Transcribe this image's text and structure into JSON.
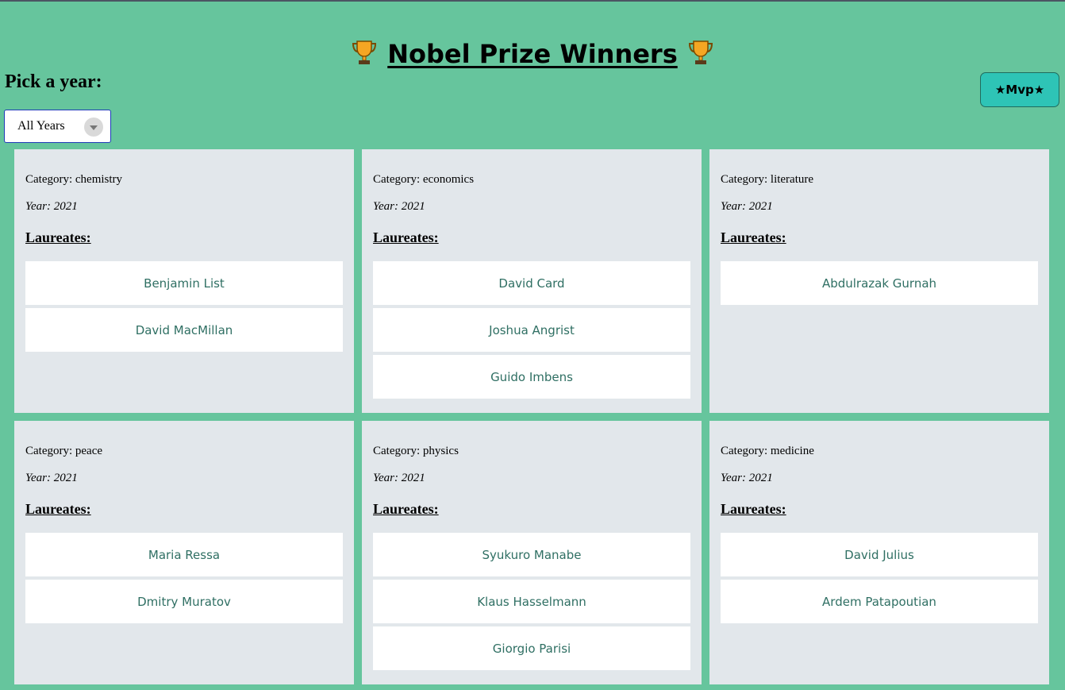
{
  "header": {
    "title": "Nobel Prize Winners",
    "icon": "trophy-icon"
  },
  "filter": {
    "label": "Pick a year:",
    "selected": "All Years"
  },
  "mvp_button": "★Mvp★",
  "colors": {
    "background": "#66c59d",
    "card": "#e2e7eb",
    "laureate_text": "#2f6f63",
    "button": "#2ec4b6"
  },
  "prizes": [
    {
      "category": "Category: chemistry",
      "year": "Year: 2021",
      "heading": "Laureates:",
      "laureates": [
        "Benjamin List",
        "David MacMillan"
      ]
    },
    {
      "category": "Category: economics",
      "year": "Year: 2021",
      "heading": "Laureates:",
      "laureates": [
        "David Card",
        "Joshua Angrist",
        "Guido Imbens"
      ]
    },
    {
      "category": "Category: literature",
      "year": "Year: 2021",
      "heading": "Laureates:",
      "laureates": [
        "Abdulrazak Gurnah"
      ]
    },
    {
      "category": "Category: peace",
      "year": "Year: 2021",
      "heading": "Laureates:",
      "laureates": [
        "Maria Ressa",
        "Dmitry Muratov"
      ]
    },
    {
      "category": "Category: physics",
      "year": "Year: 2021",
      "heading": "Laureates:",
      "laureates": [
        "Syukuro Manabe",
        "Klaus Hasselmann",
        "Giorgio Parisi"
      ]
    },
    {
      "category": "Category: medicine",
      "year": "Year: 2021",
      "heading": "Laureates:",
      "laureates": [
        "David Julius",
        "Ardem Patapoutian"
      ]
    }
  ]
}
